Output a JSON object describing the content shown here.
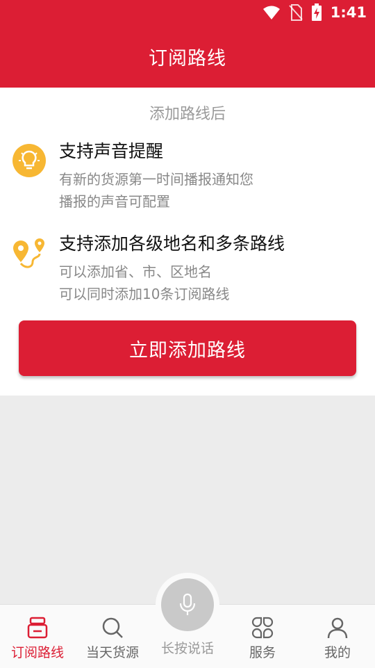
{
  "status_bar": {
    "time": "1:41",
    "icons": [
      "wifi-icon",
      "no-sim-icon",
      "battery-charging-icon"
    ]
  },
  "header": {
    "title": "订阅路线"
  },
  "intro": {
    "subtitle": "添加路线后",
    "features": [
      {
        "icon": "lightbulb-icon",
        "title": "支持声音提醒",
        "lines": [
          "有新的货源第一时间播报通知您",
          "播报的声音可配置"
        ]
      },
      {
        "icon": "route-pin-icon",
        "title": "支持添加各级地名和多条路线",
        "lines": [
          "可以添加省、市、区地名",
          "可以同时添加10条订阅路线"
        ]
      }
    ],
    "button_label": "立即添加路线"
  },
  "bottom_nav": {
    "items": [
      {
        "label": "订阅路线",
        "icon": "subscribe-route-icon",
        "active": true
      },
      {
        "label": "当天货源",
        "icon": "search-icon",
        "active": false
      },
      {
        "label": "长按说话",
        "icon": "microphone-icon",
        "active": false
      },
      {
        "label": "服务",
        "icon": "services-grid-icon",
        "active": false
      },
      {
        "label": "我的",
        "icon": "user-icon",
        "active": false
      }
    ]
  },
  "colors": {
    "primary": "#dc1e34",
    "icon_yellow": "#f7b733",
    "background": "#ececec"
  }
}
